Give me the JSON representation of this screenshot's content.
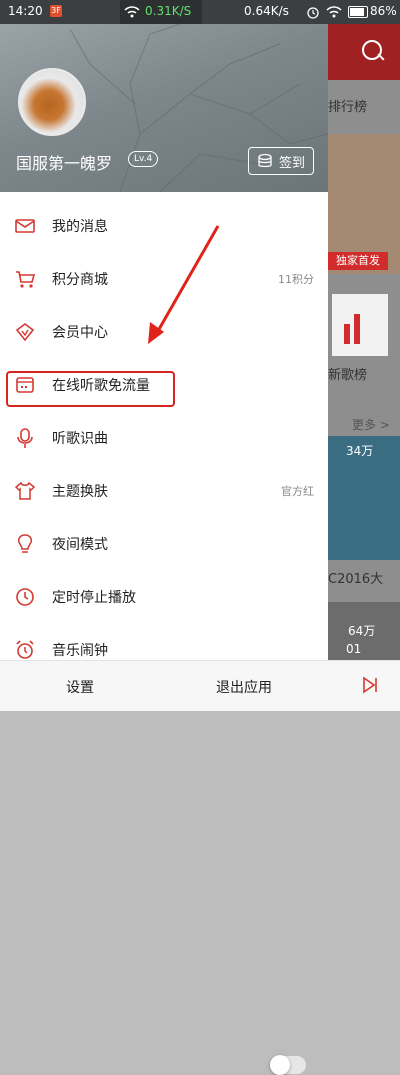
{
  "status_bar": {
    "time": "14:20",
    "badge": "3F",
    "speed_current": "0.31K/S",
    "speed_other": "0.64K/s",
    "battery": "86%"
  },
  "background_app": {
    "tab_text": "排行榜",
    "exclusive_badge": "独家首发",
    "new_songs": "新歌榜",
    "more": "更多 >",
    "play_count_1": "34万",
    "playlist_title": "C2016大",
    "play_count_2": "64万",
    "num_small": "01"
  },
  "profile": {
    "username": "国服第一魄罗",
    "level": "Lv.4",
    "signin_label": "签到"
  },
  "menu": [
    {
      "label": "我的消息",
      "icon": "mail-icon",
      "right": ""
    },
    {
      "label": "积分商城",
      "icon": "cart-icon",
      "right": "11积分"
    },
    {
      "label": "会员中心",
      "icon": "vip-diamond-icon",
      "right": ""
    },
    {
      "label": "在线听歌免流量",
      "icon": "sim-card-icon",
      "right": ""
    },
    {
      "label": "听歌识曲",
      "icon": "microphone-icon",
      "right": ""
    },
    {
      "label": "主题换肤",
      "icon": "tshirt-icon",
      "right": "官方红"
    },
    {
      "label": "夜间模式",
      "icon": "lightbulb-icon",
      "right": ""
    },
    {
      "label": "定时停止播放",
      "icon": "clock-icon",
      "right": ""
    },
    {
      "label": "音乐闹钟",
      "icon": "alarm-icon",
      "right": ""
    }
  ],
  "night_mode_on": false,
  "bottom": {
    "settings": "设置",
    "exit": "退出应用"
  },
  "colors": {
    "accent": "#d7261f",
    "icon_red": "#d33a31"
  }
}
